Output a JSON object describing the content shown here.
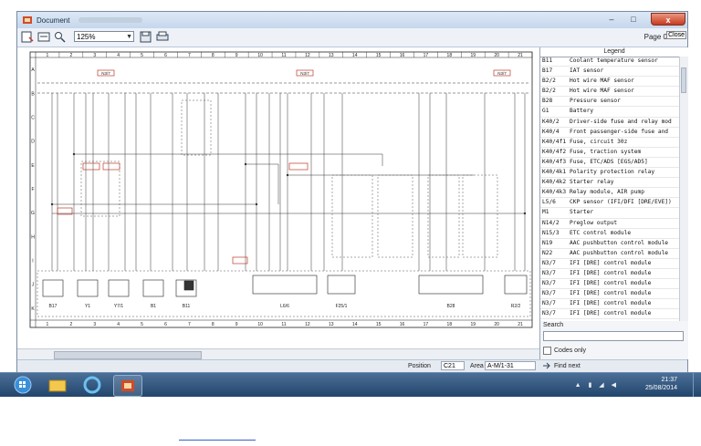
{
  "window": {
    "title": "Document",
    "close_label": "x"
  },
  "toolbar": {
    "zoom_value": "125%",
    "page_label": "Page",
    "page_number": "0",
    "close_label": "Close"
  },
  "schematic": {
    "grid_numbers": [
      "1",
      "2",
      "3",
      "4",
      "5",
      "6",
      "7",
      "8",
      "9",
      "10",
      "11",
      "12",
      "13",
      "14",
      "15",
      "16",
      "17",
      "18",
      "19",
      "20",
      "21"
    ],
    "row_letters": [
      "A",
      "B",
      "C",
      "D",
      "E",
      "F",
      "G",
      "H",
      "I",
      "J",
      "K"
    ],
    "component_labels": [
      "B17",
      "Y1",
      "Y7/1",
      "B1",
      "B11",
      "L6/6",
      "F25/1",
      "B28",
      "R2/2",
      "N3/7"
    ]
  },
  "legend": {
    "title": "Legend",
    "items": [
      {
        "code": "B11",
        "desc": "Coolant temperature sensor"
      },
      {
        "code": "B17",
        "desc": "IAT sensor"
      },
      {
        "code": "B2/2",
        "desc": "Hot wire MAF sensor"
      },
      {
        "code": "B2/2",
        "desc": "Hot wire MAF sensor"
      },
      {
        "code": "B28",
        "desc": "Pressure sensor"
      },
      {
        "code": "G1",
        "desc": "Battery"
      },
      {
        "code": "K40/2",
        "desc": "Driver-side fuse and relay mod"
      },
      {
        "code": "K40/4",
        "desc": "Front passenger-side fuse and"
      },
      {
        "code": "K40/4f1",
        "desc": "Fuse, circuit 30z"
      },
      {
        "code": "K40/4f2",
        "desc": "Fuse, traction system"
      },
      {
        "code": "K40/4f3",
        "desc": "Fuse, ETC/ADS [EGS/AD5]"
      },
      {
        "code": "K40/4k1",
        "desc": "Polarity protection relay"
      },
      {
        "code": "K40/4k2",
        "desc": "Starter relay"
      },
      {
        "code": "K40/4k3",
        "desc": "Relay module, AIR pump"
      },
      {
        "code": "L5/6",
        "desc": "CKP sensor (IFI/DFI [DRE/EVE])"
      },
      {
        "code": "M1",
        "desc": "Starter"
      },
      {
        "code": "N14/2",
        "desc": "Preglow output"
      },
      {
        "code": "N15/3",
        "desc": "ETC control module"
      },
      {
        "code": "N19",
        "desc": "AAC pushbutton control module"
      },
      {
        "code": "N22",
        "desc": "AAC pushbutton control module"
      },
      {
        "code": "N3/7",
        "desc": "IFI [DRE] control module"
      },
      {
        "code": "N3/7",
        "desc": "IFI [DRE] control module"
      },
      {
        "code": "N3/7",
        "desc": "IFI [DRE] control module"
      },
      {
        "code": "N3/7",
        "desc": "IFI [DRE] control module"
      },
      {
        "code": "N3/7",
        "desc": "IFI [DRE] control module"
      },
      {
        "code": "N3/7",
        "desc": "IFI [DRE] control module"
      },
      {
        "code": "N3/7",
        "desc": "IFI [DRE] control module"
      },
      {
        "code": "N3/7",
        "desc": "IFI [DRE] control module"
      }
    ]
  },
  "search": {
    "label": "Search",
    "value": "",
    "codes_only_label": "Codes only",
    "find_next_label": "Find next"
  },
  "status": {
    "position_label": "Position",
    "position_value": "C21",
    "area_label": "Area",
    "area_value": "A-M/1-31"
  },
  "taskbar": {
    "time": "21:37",
    "date": "25/08/2014"
  },
  "colors": {
    "titlebar": "#c6d7ec",
    "close_button": "#c63b1f",
    "taskbar": "#22456c",
    "callout_red": "#c0392b"
  }
}
